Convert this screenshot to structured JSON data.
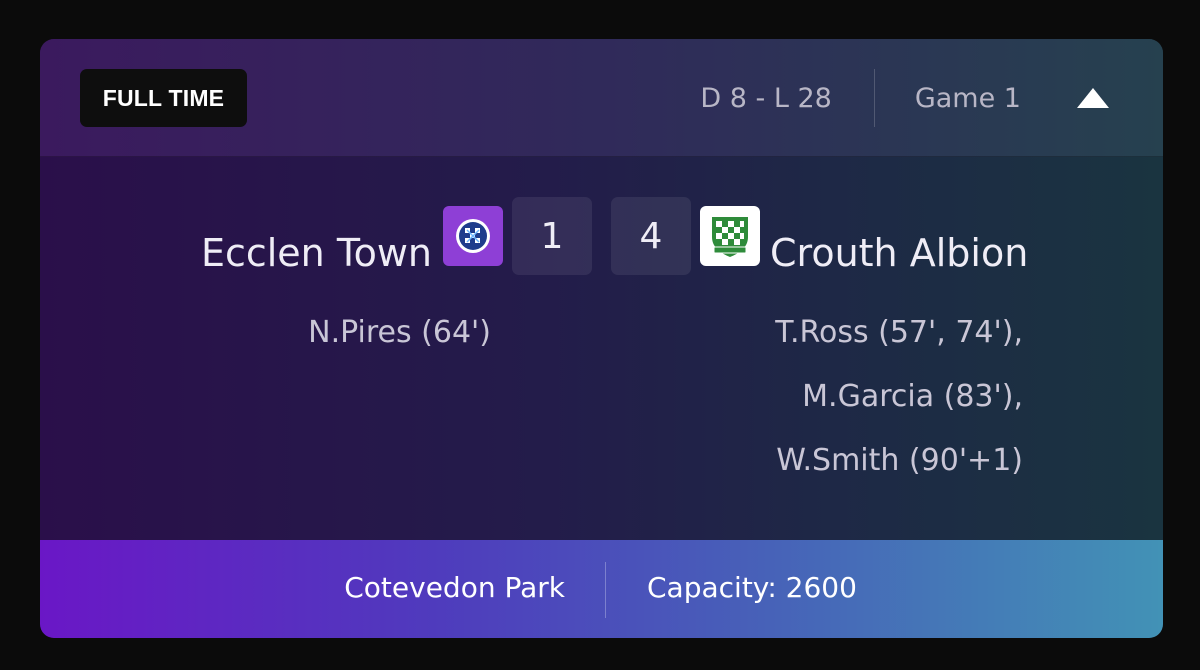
{
  "header": {
    "status": "FULL TIME",
    "record": "D 8 - L 28",
    "game": "Game 1",
    "toggle_icon": "triangle-up-icon"
  },
  "match": {
    "home": {
      "name": "Ecclen Town",
      "score": "1",
      "crest_icon": "ecclen-town-crest-icon",
      "crest_color": "#8e3fd6",
      "scorers": [
        "N.Pires (64')"
      ]
    },
    "away": {
      "name": "Crouth Albion",
      "score": "4",
      "crest_icon": "crouth-albion-crest-icon",
      "crest_color": "#2e8b3a",
      "scorers": [
        "T.Ross (57', 74'),",
        "M.Garcia (83'),",
        "W.Smith (90'+1)"
      ]
    }
  },
  "footer": {
    "venue": "Cotevedon Park",
    "capacity": "Capacity: 2600"
  },
  "colors": {
    "footer_gradient_start": "#6a17c6",
    "footer_gradient_end": "#4292b6",
    "badge_background": "#0e0e0e"
  }
}
